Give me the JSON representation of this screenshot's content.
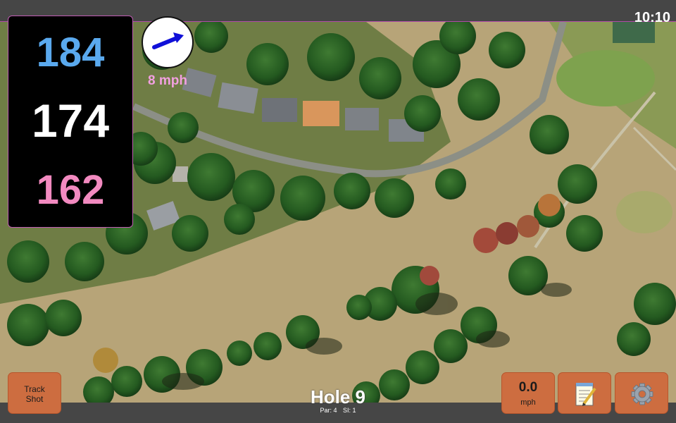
{
  "status": {
    "time": "10:10"
  },
  "yardage": {
    "back": "184",
    "middle": "174",
    "front": "162"
  },
  "wind": {
    "speed": "8 mph",
    "direction_icon": "wind-arrow-icon"
  },
  "buttons": {
    "track_shot": "Track\nShot",
    "speed_value": "0.0",
    "speed_unit": "mph",
    "notes_icon": "notepad-icon",
    "settings_icon": "gear-icon"
  },
  "hole": {
    "title": "Hole 9",
    "par": "Par: 4",
    "si": "SI: 1"
  },
  "colors": {
    "back": "#5aa9ee",
    "middle": "#ffffff",
    "front": "#f28ac0",
    "button": "#cd6d40",
    "accent": "#c05cb4"
  }
}
